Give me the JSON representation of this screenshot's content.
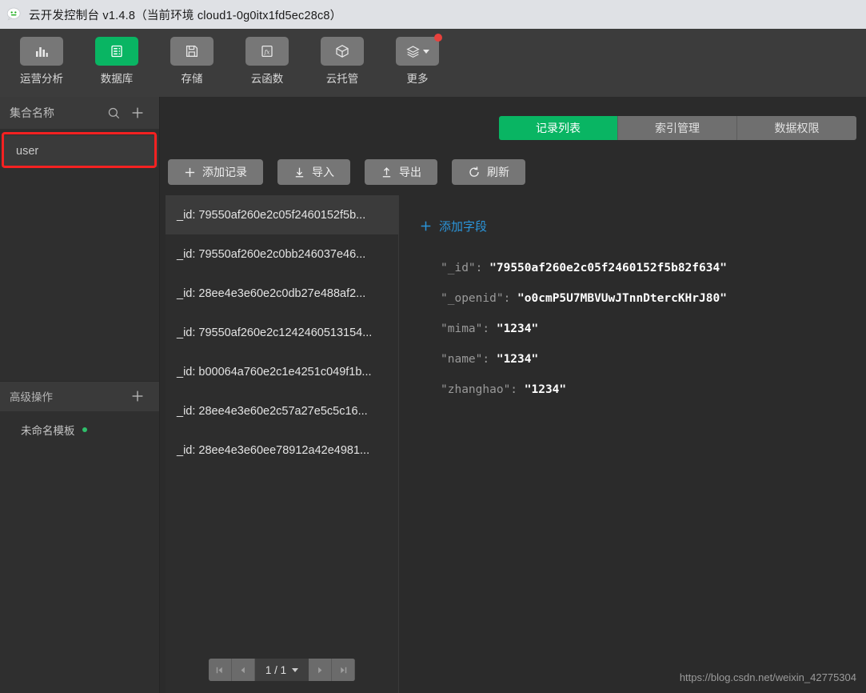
{
  "titlebar": {
    "logo_icon": "wechat-logo-icon",
    "text": "云开发控制台 v1.4.8（当前环境 cloud1-0g0itx1fd5ec28c8）"
  },
  "colors": {
    "accent_green": "#09b563",
    "link_blue": "#2b94d9",
    "highlight_red": "#f42121",
    "notify_red": "#e8413c",
    "status_green": "#2fbf6b",
    "titlebar_bg": "#dfe1e5",
    "toolbar_bg": "#3c3c3c",
    "sidebar_bg": "#2f2f2f",
    "main_bg": "#2b2b2b"
  },
  "toolbar": {
    "items": [
      {
        "label": "运营分析",
        "icon": "bar-chart-icon",
        "active": false
      },
      {
        "label": "数据库",
        "icon": "database-icon",
        "active": true
      },
      {
        "label": "存储",
        "icon": "floppy-disk-icon",
        "active": false
      },
      {
        "label": "云函数",
        "icon": "function-fx-icon",
        "active": false
      },
      {
        "label": "云托管",
        "icon": "cube-icon",
        "active": false
      },
      {
        "label": "更多",
        "icon": "layers-icon",
        "active": false,
        "has_caret": true,
        "has_badge": true
      }
    ]
  },
  "sidebar": {
    "header": {
      "title": "集合名称",
      "search_icon": "search-icon",
      "add_icon": "plus-icon"
    },
    "collections": [
      {
        "name": "user",
        "selected": true,
        "highlighted": true
      }
    ],
    "advanced": {
      "title": "高级操作",
      "add_icon": "plus-icon"
    },
    "templates": [
      {
        "name": "未命名模板",
        "status_dot": true
      }
    ]
  },
  "main": {
    "tabs": [
      {
        "label": "记录列表",
        "active": true
      },
      {
        "label": "索引管理",
        "active": false
      },
      {
        "label": "数据权限",
        "active": false
      }
    ],
    "actions": [
      {
        "label": "添加记录",
        "icon": "plus-icon"
      },
      {
        "label": "导入",
        "icon": "import-down-arrow-icon"
      },
      {
        "label": "导出",
        "icon": "export-up-arrow-icon"
      },
      {
        "label": "刷新",
        "icon": "refresh-icon"
      }
    ],
    "records": [
      {
        "label": "_id: 79550af260e2c05f2460152f5b...",
        "selected": true
      },
      {
        "label": "_id: 79550af260e2c0bb246037e46...",
        "selected": false
      },
      {
        "label": "_id: 28ee4e3e60e2c0db27e488af2...",
        "selected": false
      },
      {
        "label": "_id: 79550af260e2c1242460513154...",
        "selected": false
      },
      {
        "label": "_id: b00064a760e2c1e4251c049f1b...",
        "selected": false
      },
      {
        "label": "_id: 28ee4e3e60e2c57a27e5c5c16...",
        "selected": false
      },
      {
        "label": "_id: 28ee4e3e60ee78912a42e4981...",
        "selected": false
      }
    ],
    "pagination": {
      "first_icon": "page-first-icon",
      "prev_icon": "page-prev-icon",
      "page_text": "1 / 1",
      "caret_icon": "chevron-down-icon",
      "next_icon": "page-next-icon",
      "last_icon": "page-last-icon"
    },
    "detail": {
      "add_field_label": "添加字段",
      "add_field_icon": "plus-icon",
      "fields": [
        {
          "key": "\"_id\":",
          "value": "\"79550af260e2c05f2460152f5b82f634\""
        },
        {
          "key": "\"_openid\":",
          "value": "\"o0cmP5U7MBVUwJTnnDtercKHrJ80\""
        },
        {
          "key": "\"mima\":",
          "value": "\"1234\""
        },
        {
          "key": "\"name\":",
          "value": "\"1234\""
        },
        {
          "key": "\"zhanghao\":",
          "value": "\"1234\""
        }
      ]
    }
  },
  "watermark": "https://blog.csdn.net/weixin_42775304"
}
